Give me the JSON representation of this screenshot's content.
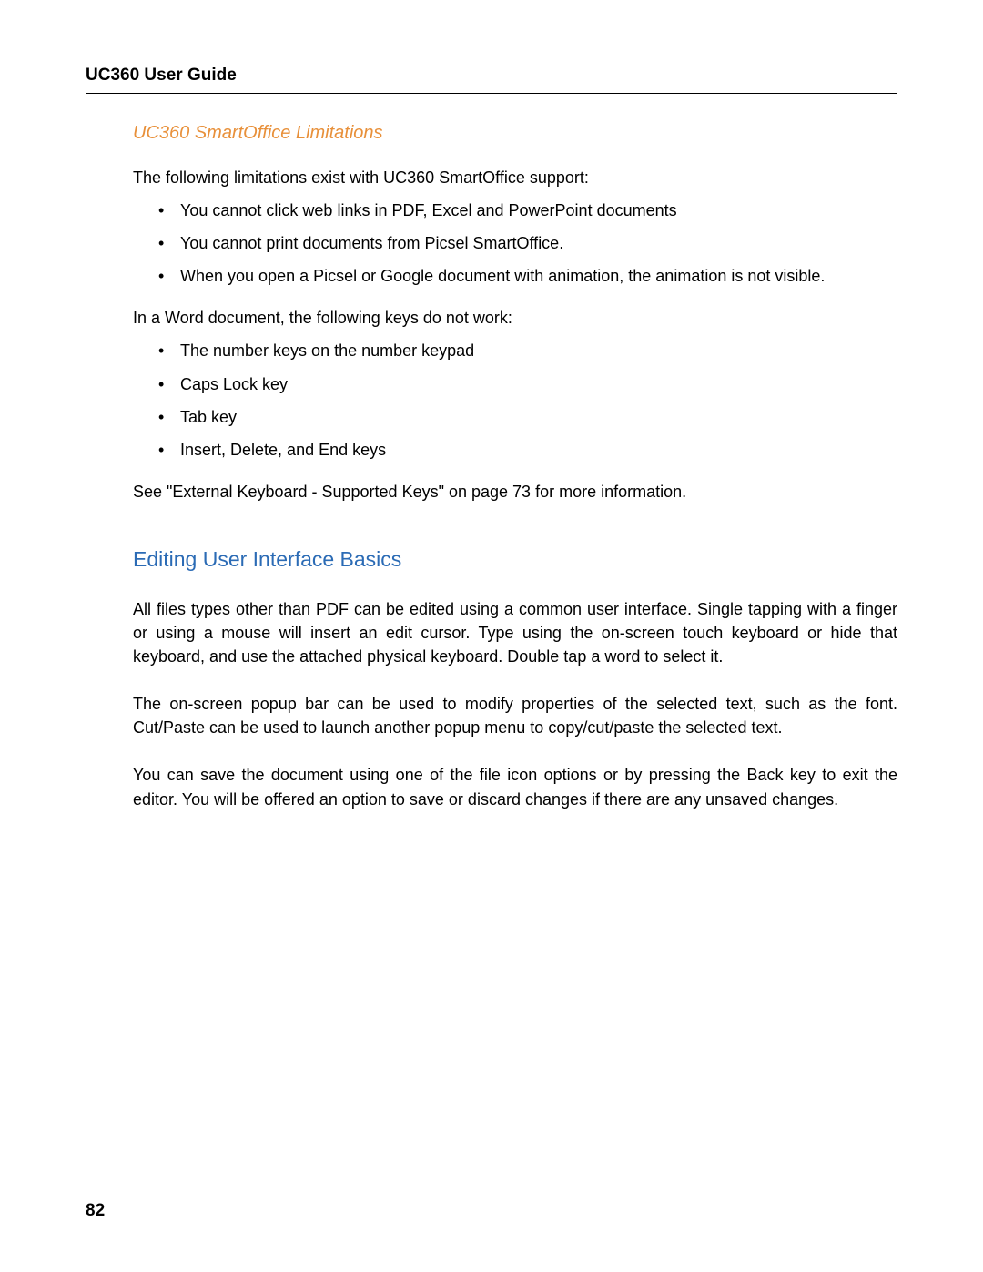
{
  "header": {
    "title": "UC360 User Guide"
  },
  "section1": {
    "heading": "UC360 SmartOffice Limitations",
    "intro": "The following limitations exist with UC360 SmartOffice support:",
    "bullets": [
      "You cannot click web links in PDF, Excel and PowerPoint documents",
      "You cannot print documents from Picsel SmartOffice.",
      "When you open a Picsel or Google document with animation, the animation is not visible."
    ],
    "intro2": "In a Word document, the following keys do not work:",
    "bullets2": [
      "The number keys on the number keypad",
      "Caps Lock key",
      "Tab key",
      "Insert, Delete, and End keys"
    ],
    "footer": "See \"External Keyboard - Supported Keys\" on page 73 for more information."
  },
  "section2": {
    "heading": "Editing User Interface Basics",
    "para1": "All files types other than PDF can be edited using a common user interface. Single tapping with a finger or using a mouse will insert an edit cursor. Type using the on-screen touch keyboard or hide that keyboard, and use the attached physical keyboard. Double tap a word to select it.",
    "para2": "The on-screen popup bar can be used to modify properties of the selected text, such as the font. Cut/Paste can be used to launch another popup menu to copy/cut/paste the selected text.",
    "para3": "You can save the document using one of the file icon options or by pressing the Back key to exit the editor. You will be offered an option to save or discard changes if there are any unsaved changes."
  },
  "pageNumber": "82"
}
